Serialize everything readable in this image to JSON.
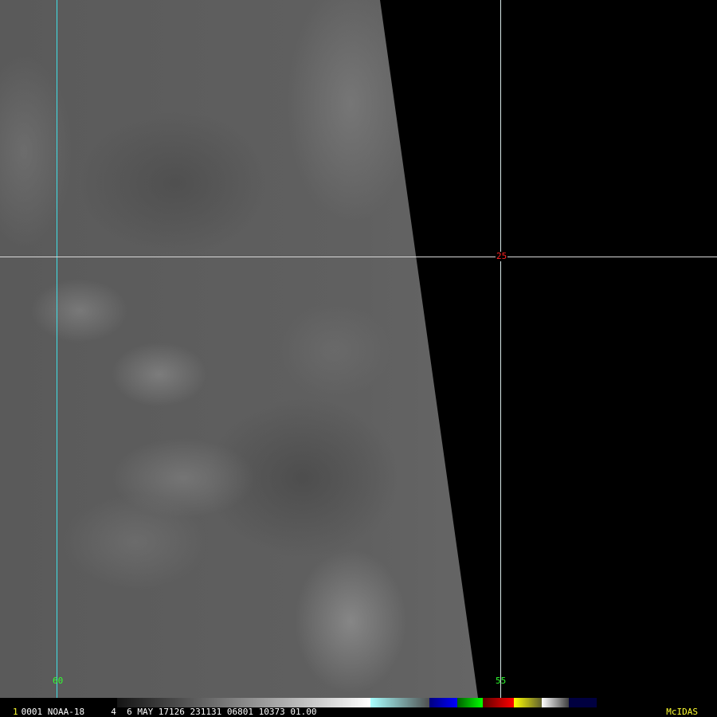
{
  "image": {
    "satellite": "NOAA-18"
  },
  "grid": {
    "lat_label": "25",
    "lon_labels": [
      "60",
      "55"
    ]
  },
  "status_bar": {
    "frame_number": "1",
    "text": "0001 NOAA-18     4  6 MAY 17126 231131 06801 10373 01.00",
    "brand": "McIDAS"
  },
  "colorbar": [
    {
      "c": "linear-gradient(90deg,#141414,#f0f0f0)",
      "w": 300
    },
    {
      "c": "linear-gradient(90deg,#f0f0f0,#ffffff)",
      "w": 18
    },
    {
      "c": "linear-gradient(90deg,#a8ffff,#505050)",
      "w": 74
    },
    {
      "c": "linear-gradient(90deg,#000080,#0000ff)",
      "w": 35
    },
    {
      "c": "linear-gradient(90deg,#006000,#00ff00)",
      "w": 32
    },
    {
      "c": "linear-gradient(90deg,#600000,#ff0000)",
      "w": 39
    },
    {
      "c": "linear-gradient(90deg,#ffff00,#606030)",
      "w": 35
    },
    {
      "c": "linear-gradient(90deg,#ffffff,#404040)",
      "w": 34
    },
    {
      "c": "#000040",
      "w": 35
    }
  ]
}
